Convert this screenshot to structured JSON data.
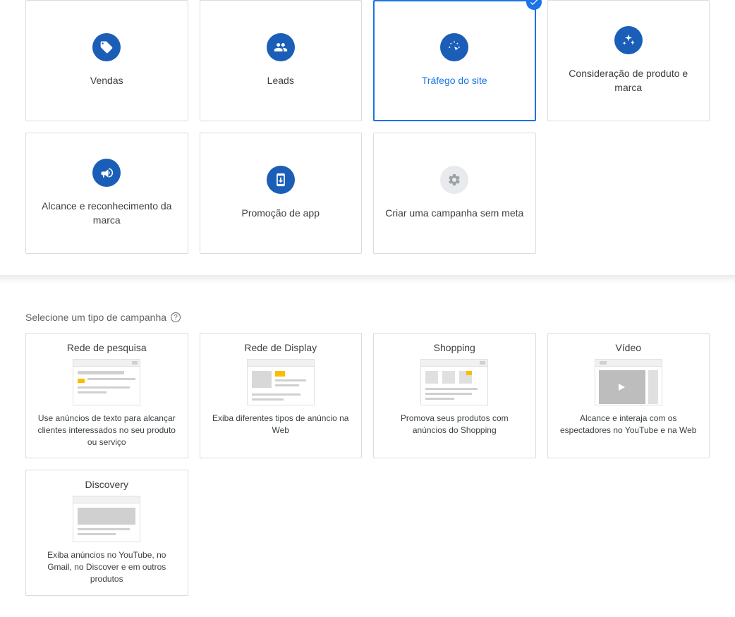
{
  "goals": [
    {
      "label": "Vendas",
      "icon": "tag-icon",
      "selected": false,
      "variant": "blue"
    },
    {
      "label": "Leads",
      "icon": "people-icon",
      "selected": false,
      "variant": "blue"
    },
    {
      "label": "Tráfego do site",
      "icon": "click-icon",
      "selected": true,
      "variant": "blue"
    },
    {
      "label": "Consideração de produto e marca",
      "icon": "sparkle-icon",
      "selected": false,
      "variant": "blue"
    },
    {
      "label": "Alcance e reconhecimento da marca",
      "icon": "megaphone-icon",
      "selected": false,
      "variant": "blue"
    },
    {
      "label": "Promoção de app",
      "icon": "app-download-icon",
      "selected": false,
      "variant": "blue"
    },
    {
      "label": "Criar uma campanha sem meta",
      "icon": "gear-icon",
      "selected": false,
      "variant": "grey"
    }
  ],
  "type_section_heading": "Selecione um tipo de campanha",
  "campaign_types": [
    {
      "title": "Rede de pesquisa",
      "desc": "Use anúncios de texto para alcançar clientes interessados no seu produto ou serviço",
      "thumb": "search"
    },
    {
      "title": "Rede de Display",
      "desc": "Exiba diferentes tipos de anúncio na Web",
      "thumb": "display"
    },
    {
      "title": "Shopping",
      "desc": "Promova seus produtos com anúncios do Shopping",
      "thumb": "shopping"
    },
    {
      "title": "Vídeo",
      "desc": "Alcance e interaja com os espectadores no YouTube e na Web",
      "thumb": "video"
    },
    {
      "title": "Discovery",
      "desc": "Exiba anúncios no YouTube, no Gmail, no Discover e em outros produtos",
      "thumb": "discovery"
    }
  ]
}
